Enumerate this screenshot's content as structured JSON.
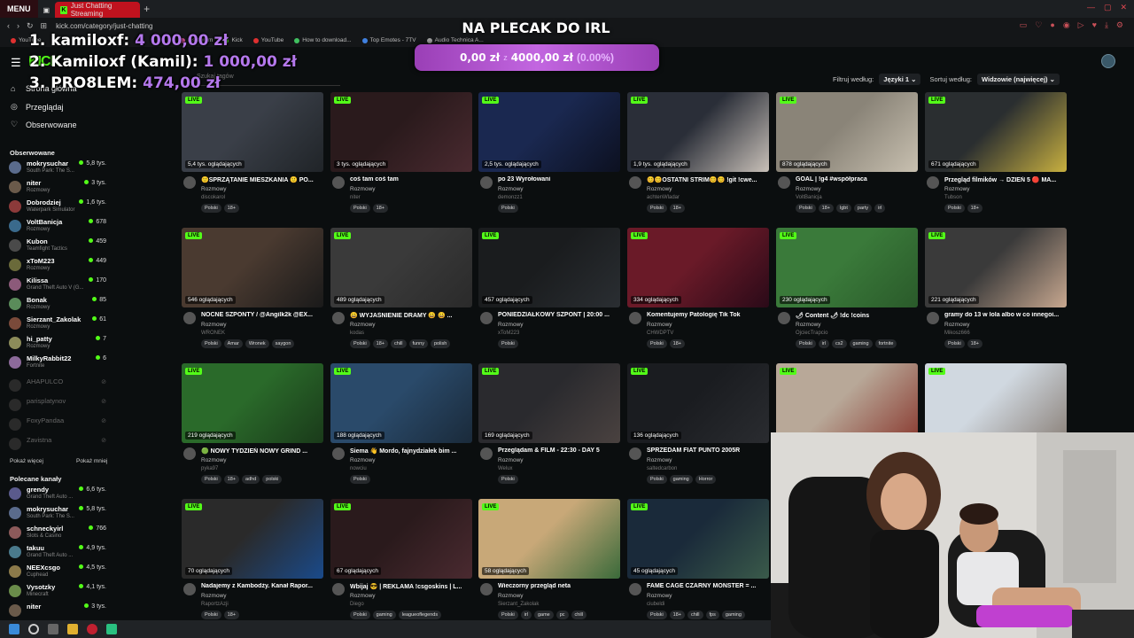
{
  "browser": {
    "menu_label": "MENU",
    "active_tab": "Just Chatting Streaming",
    "new_tab": "+",
    "url": "kick.com/category/just-chatting",
    "bookmarks": [
      "YouTube",
      "Instagram",
      "Kick",
      "YouTube",
      "How to download...",
      "Top Emotes - 7TV",
      "Audio Technica A..."
    ]
  },
  "header": {
    "logo": "KICK"
  },
  "sidebar": {
    "nav": [
      {
        "label": "Strona główna",
        "icon": "home-icon"
      },
      {
        "label": "Przeglądaj",
        "icon": "compass-icon"
      },
      {
        "label": "Obserwowane",
        "icon": "heart-icon"
      }
    ],
    "followed_heading": "Obserwowane",
    "followed": [
      {
        "name": "mokrysuchar",
        "game": "South Park: The S...",
        "viewers": "5,8 tys.",
        "color": "#5a6b8c"
      },
      {
        "name": "niter",
        "game": "Rozmowy",
        "viewers": "3 tys.",
        "color": "#6a5a4a"
      },
      {
        "name": "Dobrodziej",
        "game": "Waterpark Simulator",
        "viewers": "1,6 tys.",
        "color": "#8c3a3a"
      },
      {
        "name": "VoltBanicja",
        "game": "Rozmowy",
        "viewers": "678",
        "color": "#3a6a8c"
      },
      {
        "name": "Kubon",
        "game": "Teamfight Tactics",
        "viewers": "459",
        "color": "#4a4a4a"
      },
      {
        "name": "xToM223",
        "game": "Rozmowy",
        "viewers": "449",
        "color": "#6a6a3a"
      },
      {
        "name": "Kilissa",
        "game": "Grand Theft Auto V (G...",
        "viewers": "170",
        "color": "#8c5a7a"
      },
      {
        "name": "Bonak",
        "game": "Rozmowy",
        "viewers": "85",
        "color": "#5a8c5a"
      },
      {
        "name": "Sierzant_Zakolak",
        "game": "Rozmowy",
        "viewers": "61",
        "color": "#7a4a3a"
      },
      {
        "name": "hi_patty",
        "game": "Rozmowy",
        "viewers": "7",
        "color": "#8c8c5a"
      },
      {
        "name": "MilkyRabbit22",
        "game": "Fortnite",
        "viewers": "6",
        "color": "#8c6a9a"
      }
    ],
    "offline": [
      {
        "name": "AHAPULCO",
        "viewers": "⊘"
      },
      {
        "name": "parisplatynov",
        "viewers": "⊘"
      },
      {
        "name": "FoxyPandaa",
        "viewers": "⊘"
      },
      {
        "name": "Zavistna",
        "viewers": "⊘"
      }
    ],
    "show_more": "Pokaż więcej",
    "show_less": "Pokaż mniej",
    "recommended_heading": "Polecane kanały",
    "recommended": [
      {
        "name": "grendy",
        "game": "Grand Theft Auto ...",
        "viewers": "6,6 tys.",
        "color": "#5a5a8c"
      },
      {
        "name": "mokrysuchar",
        "game": "South Park: The S...",
        "viewers": "5,8 tys.",
        "color": "#5a6b8c"
      },
      {
        "name": "schneckyirl",
        "game": "Slots & Casino",
        "viewers": "766",
        "color": "#8c5a5a"
      },
      {
        "name": "takuu",
        "game": "Grand Theft Auto ...",
        "viewers": "4,9 tys.",
        "color": "#4a7a8c"
      },
      {
        "name": "NEEXcsgo",
        "game": "Cuphead",
        "viewers": "4,5 tys.",
        "color": "#8c7a4a"
      },
      {
        "name": "Vysotzky",
        "game": "Minecraft",
        "viewers": "4,1 tys.",
        "color": "#6a8c4a"
      },
      {
        "name": "niter",
        "game": "",
        "viewers": "3 tys.",
        "color": "#6a5a4a"
      }
    ]
  },
  "filters": {
    "search_placeholder": "Szukaj tagów",
    "filter_by": "Filtruj według:",
    "languages": "Języki",
    "languages_count": "1",
    "sort_by": "Sortuj według:",
    "sort_value": "Widzowie (najwięcej)"
  },
  "live_label": "LIVE",
  "streams": [
    {
      "viewers": "5,4 tys. oglądających",
      "title": "🙂SPRZĄTANIE MIESZKANIA 🙂 PO...",
      "category": "Rozmowy",
      "user": "discokarol",
      "tags": [
        "Polski",
        "18+"
      ],
      "bg": "#3a3f48",
      "bg2": "#202428"
    },
    {
      "viewers": "3 tys. oglądających",
      "title": "coś tam coś tam",
      "category": "Rozmowy",
      "user": "niter",
      "tags": [
        "Polski",
        "18+"
      ],
      "bg": "#2a1a1c",
      "bg2": "#4a2a30"
    },
    {
      "viewers": "2,5 tys. oglądających",
      "title": "po 23 Wyrołowani",
      "category": "Rozmowy",
      "user": "demonzz1",
      "tags": [
        "Polski"
      ],
      "bg": "#1a2850",
      "bg2": "#0c1020"
    },
    {
      "viewers": "1,9 tys. oglądających",
      "title": "😊😊OSTATNI STRIM😊😊 !git !cwe...",
      "category": "Rozmowy",
      "user": "achtenWladar",
      "tags": [
        "Polski",
        "18+"
      ],
      "bg": "#2a2e38",
      "bg2": "#c8c0b8"
    },
    {
      "viewers": "878 oglądających",
      "title": "GOAL | !g4 #współpraca",
      "category": "Rozmowy",
      "user": "VoltBanicja",
      "tags": [
        "Polski",
        "18+",
        "lgbt",
        "party",
        "irl"
      ],
      "bg": "#8a8478",
      "bg2": "#c8c0b0"
    },
    {
      "viewers": "671 oglądających",
      "title": "Przegląd filmików → DZIEŃ 5 🔴 MA...",
      "category": "Rozmowy",
      "user": "Tubson",
      "tags": [
        "Polski",
        "18+"
      ],
      "bg": "#2a2e30",
      "bg2": "#c8b040"
    },
    {
      "viewers": "546 oglądających",
      "title": "NOCNE SZPONTY / @Angilk2k @EX...",
      "category": "Rozmowy",
      "user": "WRONEK",
      "tags": [
        "Polski",
        "Amar",
        "Wronek",
        "saygon"
      ],
      "bg": "#4a3a30",
      "bg2": "#1a1a1a"
    },
    {
      "viewers": "489 oglądających",
      "title": "😀 WYJAŚNIENIE DRAMY 😀 😀 ...",
      "category": "Rozmowy",
      "user": "kodas",
      "tags": [
        "Polski",
        "18+",
        "chill",
        "funny",
        "polish"
      ],
      "bg": "#3a3a3a",
      "bg2": "#2a2a2a"
    },
    {
      "viewers": "457 oglądających",
      "title": "PONIEDZIAŁKOWY SZPONT | 20:00 ...",
      "category": "Rozmowy",
      "user": "xToM223",
      "tags": [
        "Polski"
      ],
      "bg": "#1a1c1e",
      "bg2": "#2a2e32"
    },
    {
      "viewers": "334 oglądających",
      "title": "Komentujemy Patologię Tik Tok",
      "category": "Rozmowy",
      "user": "CHWDPTV",
      "tags": [
        "Polski",
        "18+"
      ],
      "bg": "#6a1a28",
      "bg2": "#2a0a18"
    },
    {
      "viewers": "230 oglądających",
      "title": "🌶 Content 🌶 !dc !coins",
      "category": "Rozmowy",
      "user": "OjciecTrapcio",
      "tags": [
        "Polski",
        "irl",
        "cs2",
        "gaming",
        "fortnite"
      ],
      "bg": "#3a7a3a",
      "bg2": "#2a5a2a"
    },
    {
      "viewers": "221 oglądających",
      "title": "gramy do 13 w lola albo w co innegoi...",
      "category": "Rozmowy",
      "user": "Mikosz666",
      "tags": [
        "Polski",
        "18+"
      ],
      "bg": "#3a3a3a",
      "bg2": "#c8a890"
    },
    {
      "viewers": "219 oglądających",
      "title": "🟢 NOWY TYDZIEŃ NOWY GRIND ...",
      "category": "Rozmowy",
      "user": "pyka97",
      "tags": [
        "Polski",
        "18+",
        "adhd",
        "polski"
      ],
      "bg": "#2a6a2a",
      "bg2": "#1a3a1a"
    },
    {
      "viewers": "188 oglądających",
      "title": "Siema 👋 Mordo, fajnydziałek bim ...",
      "category": "Rozmowy",
      "user": "nowciu",
      "tags": [
        "Polski"
      ],
      "bg": "#2a4a6a",
      "bg2": "#1a2a3a"
    },
    {
      "viewers": "169 oglądających",
      "title": "Przeglądam & FILM - 22:30 - DAY 5",
      "category": "Rozmowy",
      "user": "Welux",
      "tags": [
        "Polski"
      ],
      "bg": "#2a2a2e",
      "bg2": "#4a4240"
    },
    {
      "viewers": "136 oglądających",
      "title": "SPRZEDAM FIAT PUNTO 2005R",
      "category": "Rozmowy",
      "user": "saltedcarbon",
      "tags": [
        "Polski",
        "gaming",
        "Horror"
      ],
      "bg": "#1a1c20",
      "bg2": "#2a2c30"
    },
    {
      "viewers": "",
      "title": "",
      "category": "",
      "user": "",
      "tags": [],
      "bg": "#b8a898",
      "bg2": "#8a3a30"
    },
    {
      "viewers": "",
      "title": "",
      "category": "",
      "user": "",
      "tags": [],
      "bg": "#d0d8e0",
      "bg2": "#8a8078"
    },
    {
      "viewers": "70 oglądających",
      "title": "Nadajemy z Kambodży. Kanał Rapor...",
      "category": "Rozmowy",
      "user": "RaportzAzji",
      "tags": [
        "Polski",
        "18+"
      ],
      "bg": "#2a2a2a",
      "bg2": "#1a4a8a"
    },
    {
      "viewers": "67 oglądających",
      "title": "Wbijaj 😎 | REKLAMA !csgoskins | L...",
      "category": "Rozmowy",
      "user": "Diego",
      "tags": [
        "Polski",
        "gaming",
        "leagueoflegends"
      ],
      "bg": "#2a1a1c",
      "bg2": "#4a2a30"
    },
    {
      "viewers": "58 oglądających",
      "title": "Wieczorny przegląd neta",
      "category": "Rozmowy",
      "user": "Sierzant_Zakolak",
      "tags": [
        "Polski",
        "irl",
        "game",
        "pc",
        "chill"
      ],
      "bg": "#c8a878",
      "bg2": "#3a6a3a"
    },
    {
      "viewers": "45 oglądających",
      "title": "FAME CAGE CZARNY MONSTER = ...",
      "category": "Rozmowy",
      "user": "ciubeldi",
      "tags": [
        "Polski",
        "18+",
        "chill",
        "fps",
        "gaming"
      ],
      "bg": "#1a2a3a",
      "bg2": "#3a5a4a"
    }
  ],
  "overlay": {
    "donors": [
      {
        "rank": "1.",
        "name": "kamiloxf:",
        "amount": "4 000,00 zł"
      },
      {
        "rank": "2.",
        "name": "Kamiloxf (Kamil):",
        "amount": "1 000,00 zł"
      },
      {
        "rank": "3.",
        "name": "PRO8LEM:",
        "amount": "474,00 zł"
      }
    ],
    "goal_title": "NA PLECAK DO IRL",
    "goal_current": "0,00 zł",
    "goal_sep": "z",
    "goal_target": "4000,00 zł",
    "goal_percent": "(0.00%)",
    "goal_progress": 0.0
  }
}
